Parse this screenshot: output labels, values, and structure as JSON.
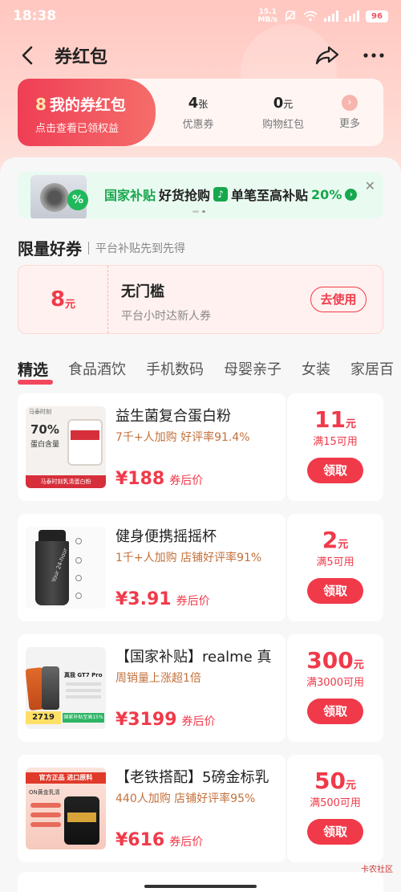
{
  "status_bar": {
    "time": "18:38",
    "net_speed_value": "15.1",
    "net_speed_unit": "MB/s",
    "battery": "96"
  },
  "nav": {
    "title": "券红包"
  },
  "my_card": {
    "title": "我的券红包",
    "subtitle": "点击查看已领权益",
    "stats": [
      {
        "value": "4",
        "unit": "张",
        "label": "优惠券"
      },
      {
        "value": "0",
        "unit": "元",
        "label": "购物红包"
      }
    ],
    "more_label": "更多"
  },
  "banner": {
    "badge": "%",
    "part1": "国家补贴",
    "part2": "好货抢购",
    "part3": "单笔至高补贴",
    "part4": "20%"
  },
  "limited_section": {
    "title": "限量好券",
    "subtitle": "平台补贴先到先得"
  },
  "limited_coupon": {
    "amount": "8",
    "unit": "元",
    "title": "无门槛",
    "subtitle": "平台小时达新人券",
    "button": "去使用"
  },
  "tabs": [
    "精选",
    "食品酒饮",
    "手机数码",
    "母婴亲子",
    "女装",
    "家居百"
  ],
  "products": [
    {
      "title": "益生菌复合蛋白粉",
      "meta": "7千+人加购  好评率91.4%",
      "price": "¥188",
      "price_label": "券后价",
      "coupon_amount": "11",
      "coupon_unit": "元",
      "coupon_condition": "满15可用",
      "button": "领取",
      "img_texts": [
        "马泰时刻",
        "70%",
        "蛋白含量",
        "马泰时刻乳清蛋白粉"
      ]
    },
    {
      "title": "健身便携摇摇杯",
      "meta": "1千+人加购  店铺好评率91%",
      "price": "¥3.91",
      "price_label": "券后价",
      "coupon_amount": "2",
      "coupon_unit": "元",
      "coupon_condition": "满5可用",
      "button": "领取",
      "img_texts": [
        "Your 24-hour"
      ]
    },
    {
      "title": "【国家补贴】realme 真",
      "meta": "周销量上涨超1倍",
      "price": "¥3199",
      "price_label": "券后价",
      "coupon_amount": "300",
      "coupon_unit": "元",
      "coupon_condition": "满3000可用",
      "button": "领取",
      "img_texts": [
        "真我 GT7 Pro",
        "2719",
        "国家补贴至高15%"
      ]
    },
    {
      "title": "【老铁搭配】5磅金标乳",
      "meta": "440人加购  店铺好评率95%",
      "price": "¥616",
      "price_label": "券后价",
      "coupon_amount": "50",
      "coupon_unit": "元",
      "coupon_condition": "满500可用",
      "button": "领取",
      "img_texts": [
        "官方正品 进口原料",
        "ON黄金乳清"
      ]
    }
  ],
  "watermark": "卡农社区",
  "colors": {
    "accent": "#f03a4a",
    "green": "#18a74d",
    "top_bg": "#ffc7c0"
  }
}
